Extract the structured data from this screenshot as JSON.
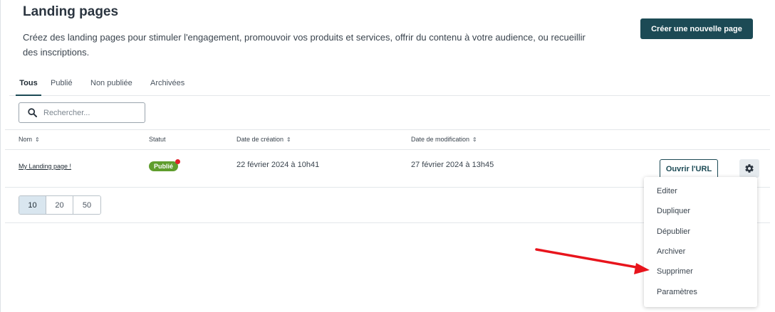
{
  "header": {
    "title": "Landing pages",
    "description": "Créez des landing pages pour stimuler l'engagement, promouvoir vos produits et services, offrir du contenu à votre audience, ou recueillir des inscriptions.",
    "create_button": "Créer une nouvelle page"
  },
  "tabs": [
    {
      "label": "Tous",
      "active": true
    },
    {
      "label": "Publié",
      "active": false
    },
    {
      "label": "Non publiée",
      "active": false
    },
    {
      "label": "Archivées",
      "active": false
    }
  ],
  "search": {
    "placeholder": "Rechercher...",
    "value": ""
  },
  "table": {
    "columns": {
      "name": "Nom",
      "status": "Statut",
      "created": "Date de création",
      "modified": "Date de modification"
    },
    "rows": [
      {
        "name": "My Landing page !",
        "status": "Publié",
        "created": "22 février 2024 à 10h41",
        "modified": "27 février 2024 à 13h45",
        "open_button": "Ouvrir l'URL"
      }
    ]
  },
  "pagination": {
    "sizes": [
      "10",
      "20",
      "50"
    ],
    "selected": "10"
  },
  "context_menu": {
    "items": [
      "Editer",
      "Dupliquer",
      "Dépublier",
      "Archiver",
      "Supprimer",
      "Paramètres"
    ]
  },
  "colors": {
    "primary": "#1c4a55",
    "published_badge": "#5f9d2d",
    "notification_dot": "#e0202a",
    "annotation_arrow": "#e8141c"
  },
  "icons": {
    "search": "search-icon",
    "gear": "gear-icon",
    "sort": "sort-icon"
  }
}
